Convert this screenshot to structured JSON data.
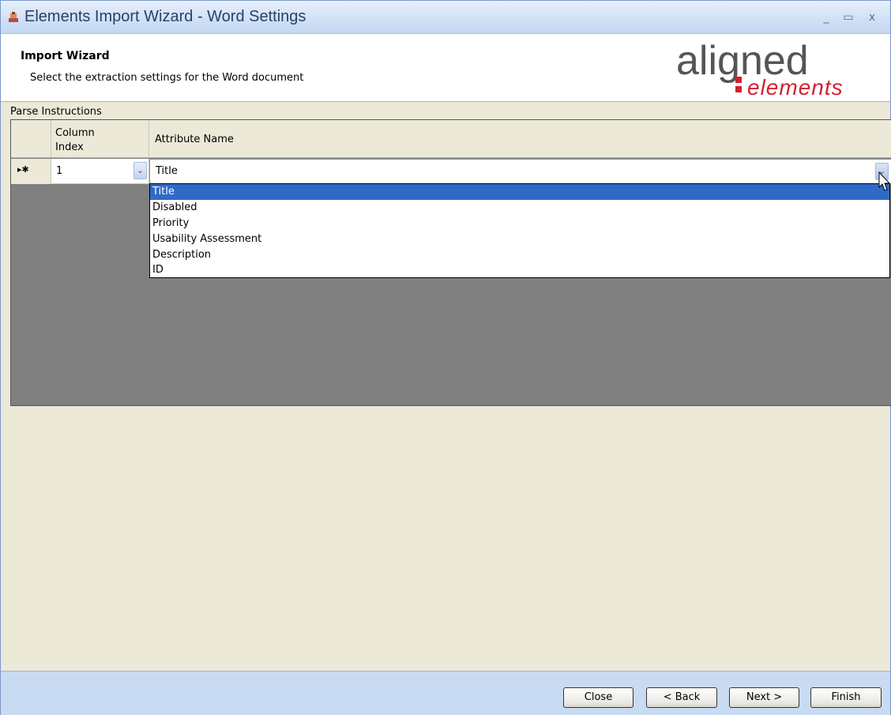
{
  "window": {
    "title": "Elements Import Wizard - Word Settings",
    "controls": {
      "minimize": "_",
      "maximize": "▭",
      "close": "x"
    }
  },
  "header": {
    "title": "Import Wizard",
    "subtitle": "Select the extraction settings for the Word document",
    "logo": {
      "word1": "aligned",
      "word2": "elements",
      "color_accent": "#D3202F"
    }
  },
  "section_label": "Parse Instructions",
  "grid": {
    "columns": [
      "Column Index",
      "Attribute Name"
    ],
    "column_index_header_line1": "Column",
    "column_index_header_line2": "Index",
    "rows": [
      {
        "row_marker": "▸✱",
        "column_index": "1",
        "attribute_name": "Title"
      }
    ]
  },
  "attribute_dropdown": {
    "options": [
      "Title",
      "Disabled",
      "Priority",
      "Usability Assessment",
      "Description",
      "ID"
    ],
    "highlighted": "Title"
  },
  "footer": {
    "close_label": "Close",
    "back_label": "< Back",
    "next_label": "Next >",
    "finish_label": "Finish"
  },
  "colors": {
    "highlight": "#316AC5",
    "grid_empty": "#808080",
    "footer_bg": "#C9DBF2"
  }
}
